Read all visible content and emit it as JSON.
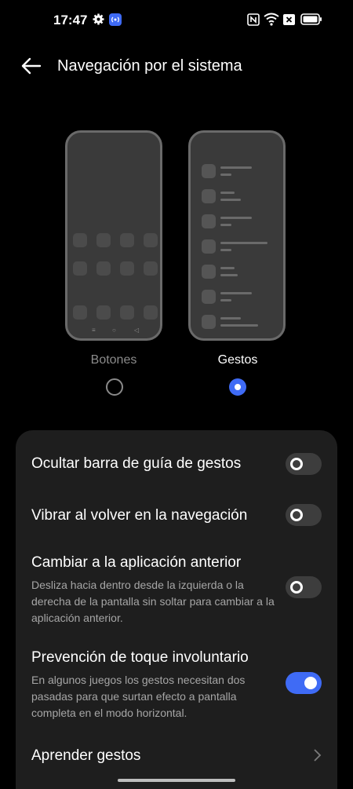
{
  "status_bar": {
    "time": "17:47"
  },
  "header": {
    "title": "Navegación por el sistema"
  },
  "options": [
    {
      "label": "Botones",
      "selected": false
    },
    {
      "label": "Gestos",
      "selected": true
    }
  ],
  "settings": [
    {
      "title": "Ocultar barra de guía de gestos",
      "toggle": false
    },
    {
      "title": "Vibrar al volver en la navegación",
      "toggle": false
    },
    {
      "title": "Cambiar a la aplicación anterior",
      "description": "Desliza hacia dentro desde la izquierda o la derecha de la pantalla sin soltar para cambiar a la aplicación anterior.",
      "toggle": false
    },
    {
      "title": "Prevención de toque involuntario",
      "description": "En algunos juegos los gestos necesitan dos pasadas para que surtan efecto a pantalla completa en el modo horizontal.",
      "toggle": true
    },
    {
      "title": "Aprender gestos"
    }
  ],
  "colors": {
    "accent": "#3f6bf5",
    "card": "#1e1e1e",
    "background": "#000000"
  }
}
